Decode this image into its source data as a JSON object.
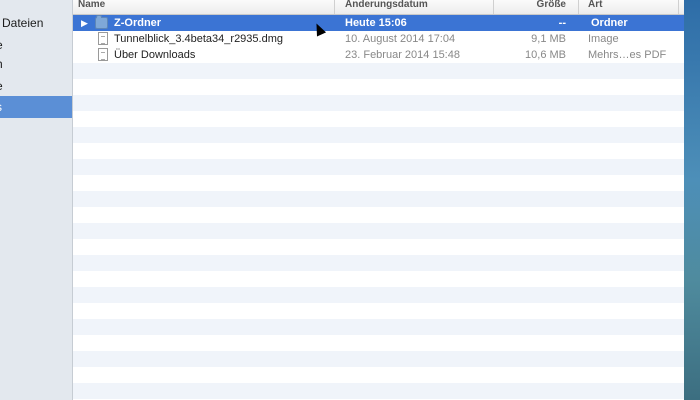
{
  "sidebar": {
    "items": [
      {
        "label": "Dateien"
      },
      {
        "label": "e"
      },
      {
        "label": "h"
      },
      {
        "label": "e"
      },
      {
        "label": "s"
      }
    ]
  },
  "columns": {
    "name": "Name",
    "date": "Änderungsdatum",
    "size": "Größe",
    "kind": "Art"
  },
  "files": [
    {
      "name": "Z-Ordner",
      "date": "Heute 15:06",
      "size": "--",
      "kind": "Ordner",
      "icon": "folder-icon",
      "selected": true
    },
    {
      "name": "Tunnelblick_3.4beta34_r2935.dmg",
      "date": "10. August 2014 17:04",
      "size": "9,1 MB",
      "kind": "Image",
      "icon": "document-icon"
    },
    {
      "name": "Über Downloads",
      "date": "23. Februar 2014 15:48",
      "size": "10,6 MB",
      "kind": "Mehrs…es PDF",
      "icon": "document-icon"
    }
  ],
  "colors": {
    "selection": "#3b74d4",
    "sidebar_selection": "#5b8fd6",
    "row_alt": "#f0f4fa"
  }
}
